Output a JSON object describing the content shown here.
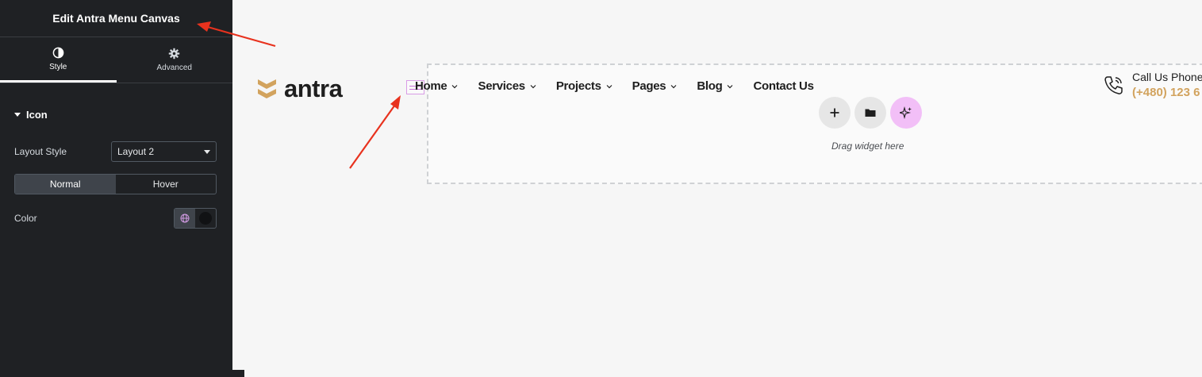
{
  "panel": {
    "title": "Edit Antra Menu Canvas",
    "tabs": [
      {
        "label": "Style",
        "icon": "contrast-icon",
        "active": true
      },
      {
        "label": "Advanced",
        "icon": "gear-icon",
        "active": false
      }
    ],
    "section": {
      "label": "Icon"
    },
    "layout_style": {
      "label": "Layout Style",
      "value": "Layout 2"
    },
    "state_toggle": {
      "normal": "Normal",
      "hover": "Hover",
      "active": "Normal"
    },
    "color": {
      "label": "Color",
      "icon": "globe-icon",
      "value": "#111214"
    }
  },
  "site": {
    "logo_text": "antra",
    "brand_color": "#d2a35e",
    "nav": [
      {
        "label": "Home",
        "has_dropdown": true
      },
      {
        "label": "Services",
        "has_dropdown": true
      },
      {
        "label": "Projects",
        "has_dropdown": true
      },
      {
        "label": "Pages",
        "has_dropdown": true
      },
      {
        "label": "Blog",
        "has_dropdown": true
      },
      {
        "label": "Contact Us",
        "has_dropdown": false
      }
    ],
    "call": {
      "title": "Call Us Phone",
      "number": "(+480) 123 6"
    },
    "drop_zone": {
      "text": "Drag widget here"
    }
  },
  "annotation_color": "#e8321e"
}
